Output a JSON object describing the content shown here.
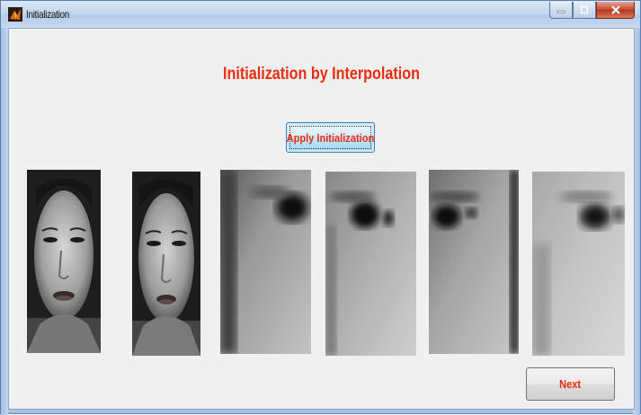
{
  "window": {
    "title": "Initialization"
  },
  "main": {
    "heading": "Initialization by Interpolation",
    "apply_button_label": "Apply Initialization",
    "next_button_label": "Next"
  },
  "images": [
    {
      "name": "face-original",
      "kind": "full-face"
    },
    {
      "name": "face-interpolated",
      "kind": "full-face"
    },
    {
      "name": "eye-crop-1",
      "kind": "eye-region"
    },
    {
      "name": "eye-crop-2",
      "kind": "eye-region"
    },
    {
      "name": "eye-crop-3",
      "kind": "eye-region"
    },
    {
      "name": "eye-crop-4",
      "kind": "eye-region"
    }
  ],
  "colors": {
    "label_red": "#ee2c10",
    "client_bg": "#f0f0f0"
  }
}
